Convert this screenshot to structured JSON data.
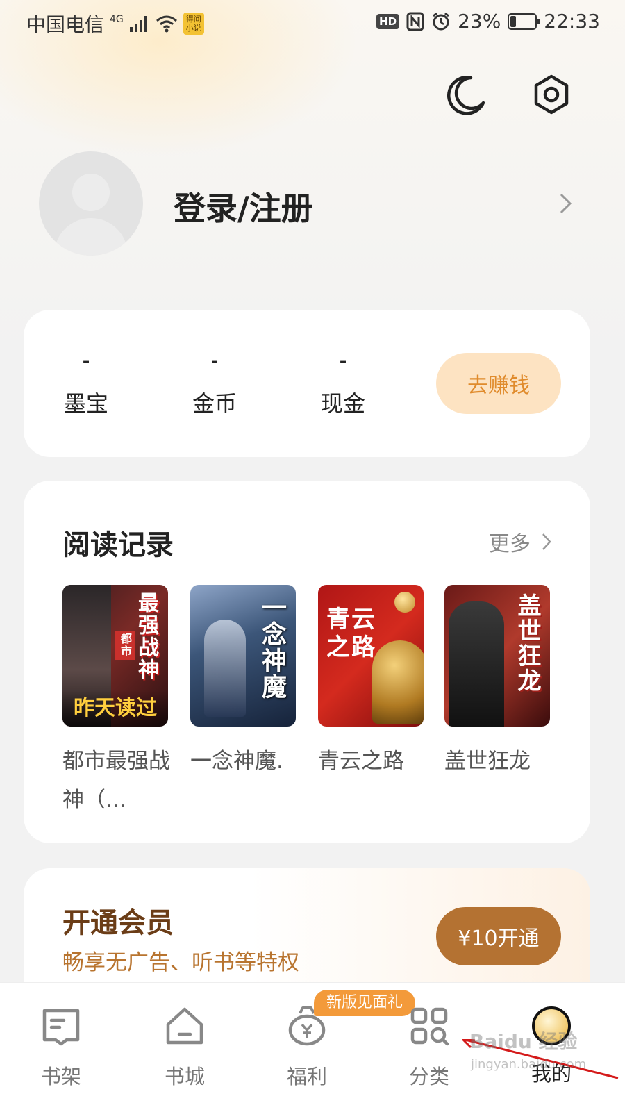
{
  "status_bar": {
    "carrier": "中国电信",
    "network": "4G",
    "badge": "得间小说",
    "battery": "23%",
    "battery_level": 0.23,
    "time": "22:33",
    "hd": "HD"
  },
  "header": {
    "night_mode_icon": "moon-icon",
    "settings_icon": "hexagon-gear-icon"
  },
  "profile": {
    "login_label": "登录/注册"
  },
  "wallet": {
    "items": [
      {
        "value": "-",
        "label": "墨宝"
      },
      {
        "value": "-",
        "label": "金币"
      },
      {
        "value": "-",
        "label": "现金"
      }
    ],
    "earn_button": "去赚钱"
  },
  "history": {
    "title": "阅读记录",
    "more": "更多",
    "books": [
      {
        "title": "都市最强战神（...",
        "cover_text": "最强战神",
        "cover_tag": "都市",
        "read_tag": "昨天读过"
      },
      {
        "title": "一念神魔.",
        "cover_text": "一念神魔"
      },
      {
        "title": "青云之路",
        "cover_text": "青云之路"
      },
      {
        "title": "盖世狂龙",
        "cover_text": "盖世狂龙"
      }
    ]
  },
  "vip": {
    "title": "开通会员",
    "subtitle": "畅享无广告、听书等特权",
    "button": "¥10开通"
  },
  "tabbar": {
    "promo_badge": "新版见面礼",
    "tabs": [
      {
        "label": "书架",
        "icon": "bookshelf-icon"
      },
      {
        "label": "书城",
        "icon": "home-icon"
      },
      {
        "label": "福利",
        "icon": "money-bag-icon"
      },
      {
        "label": "分类",
        "icon": "category-grid-icon"
      },
      {
        "label": "我的",
        "icon": "profile-icon"
      }
    ]
  },
  "watermark": {
    "text": "Baidu 经验",
    "url_text": "jingyan.baidu.com"
  },
  "colors": {
    "accent": "#e08b2c",
    "vip_brown": "#b47232",
    "promo": "#f39a3a"
  }
}
